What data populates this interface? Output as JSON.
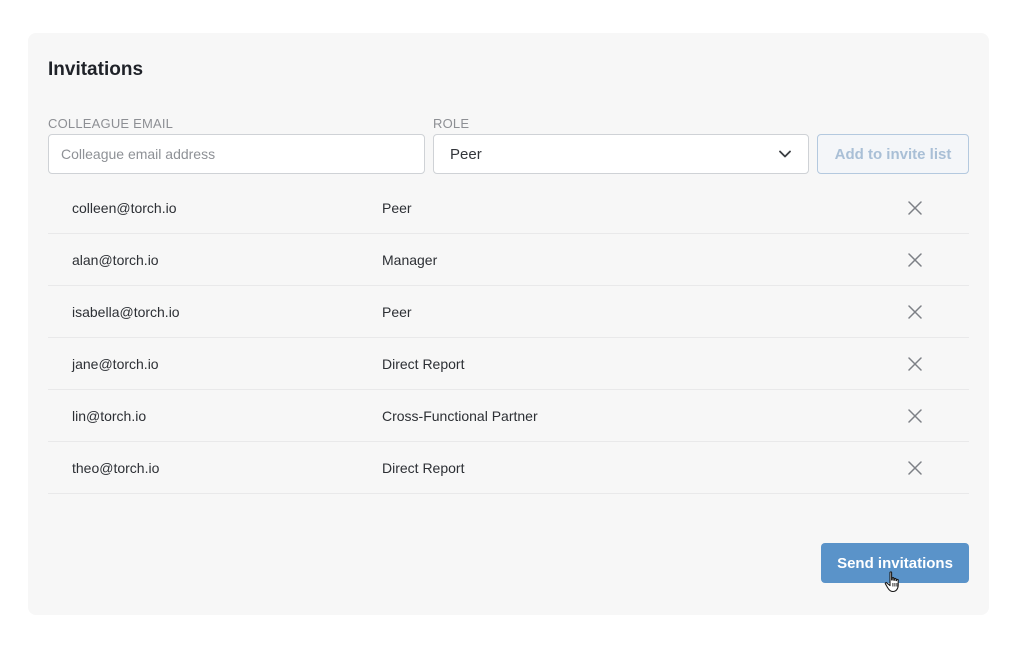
{
  "panel": {
    "title": "Invitations"
  },
  "form": {
    "email_label": "COLLEAGUE EMAIL",
    "email_placeholder": "Colleague email address",
    "email_value": "",
    "role_label": "ROLE",
    "role_selected": "Peer",
    "add_button_label": "Add to invite list"
  },
  "invites": [
    {
      "email": "colleen@torch.io",
      "role": "Peer"
    },
    {
      "email": "alan@torch.io",
      "role": "Manager"
    },
    {
      "email": "isabella@torch.io",
      "role": "Peer"
    },
    {
      "email": "jane@torch.io",
      "role": "Direct Report"
    },
    {
      "email": "lin@torch.io",
      "role": "Cross-Functional Partner"
    },
    {
      "email": "theo@torch.io",
      "role": "Direct Report"
    }
  ],
  "actions": {
    "send_label": "Send invitations"
  },
  "icons": {
    "remove": "close-icon",
    "dropdown": "chevron-down-icon",
    "pointer": "hand-cursor-icon"
  },
  "colors": {
    "primary": "#5a93c9",
    "primary_disabled": "#a9bfd6",
    "panel_background": "#f7f7f7"
  }
}
